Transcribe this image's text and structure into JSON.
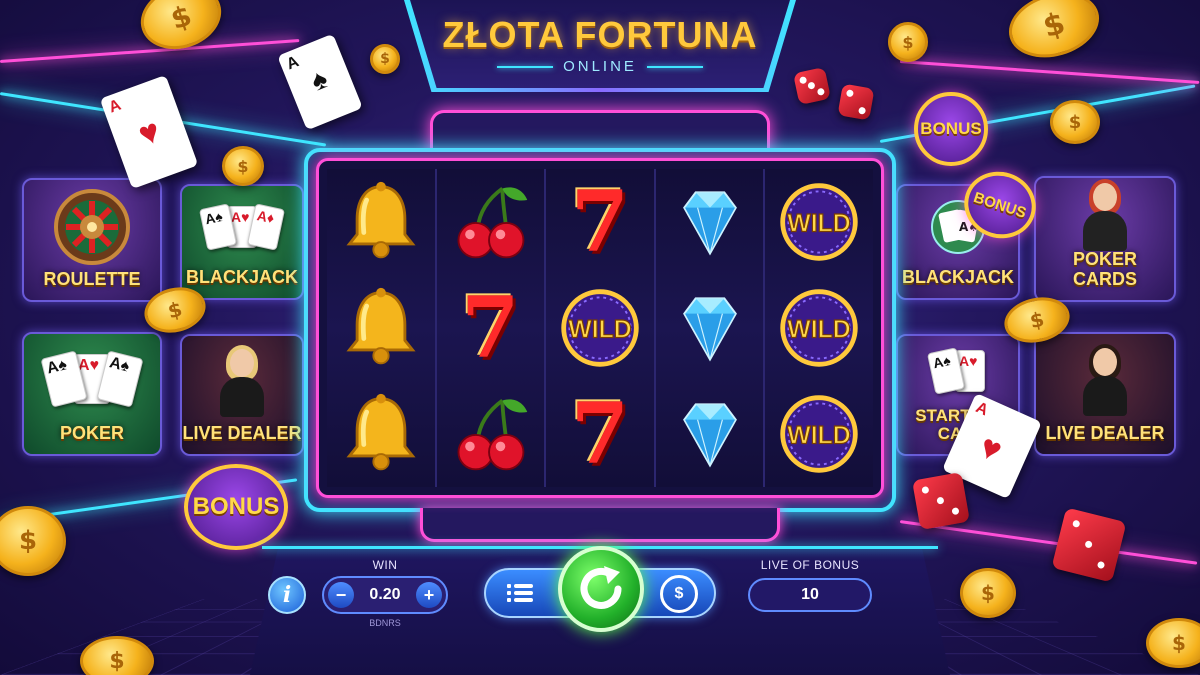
{
  "header": {
    "title": "ZŁOTA FORTUNA",
    "subtitle": "ONLINE"
  },
  "reels": [
    [
      "bell",
      "bell",
      "bell"
    ],
    [
      "cherry",
      "seven",
      "cherry"
    ],
    [
      "seven",
      "wild",
      "seven"
    ],
    [
      "diamond",
      "diamond",
      "diamond"
    ],
    [
      "wild",
      "wild",
      "wild"
    ]
  ],
  "symbols": {
    "seven": "7",
    "wild": "WILD"
  },
  "left_tiles": [
    {
      "label": "ROULETTE",
      "icon": "roulette-wheel-icon"
    },
    {
      "label": "BLACKJACK",
      "icon": "playing-cards-icon"
    },
    {
      "label": "POKER",
      "icon": "playing-cards-icon"
    },
    {
      "label": "LIVE DEALER",
      "icon": "dealer-avatar"
    }
  ],
  "right_tiles": [
    {
      "label": "BLACKJACK",
      "icon": "poker-chips-icon"
    },
    {
      "label": "POKER\nCARDS",
      "icon": "dealer-avatar"
    },
    {
      "label": "STARTING\nCASI",
      "icon": "playing-cards-icon"
    },
    {
      "label": "LIVE DEALER",
      "icon": "dealer-avatar"
    }
  ],
  "badges": {
    "bonus_label": "BONUS"
  },
  "controls": {
    "info_icon": "i",
    "win_label": "WIN",
    "win_value": "0.20",
    "win_sub": "BDNRS",
    "minus": "−",
    "plus": "+",
    "live_bonus_label": "LIVE OF BONUS",
    "live_bonus_value": "10",
    "history_glyph": "$"
  },
  "decor": {
    "coin_glyph": "$",
    "card_rank": "A"
  },
  "colors": {
    "neon_cyan": "#3fe6ff",
    "neon_pink": "#ff4fd8",
    "gold": "#ffc93c",
    "spin_green": "#22b02a"
  }
}
